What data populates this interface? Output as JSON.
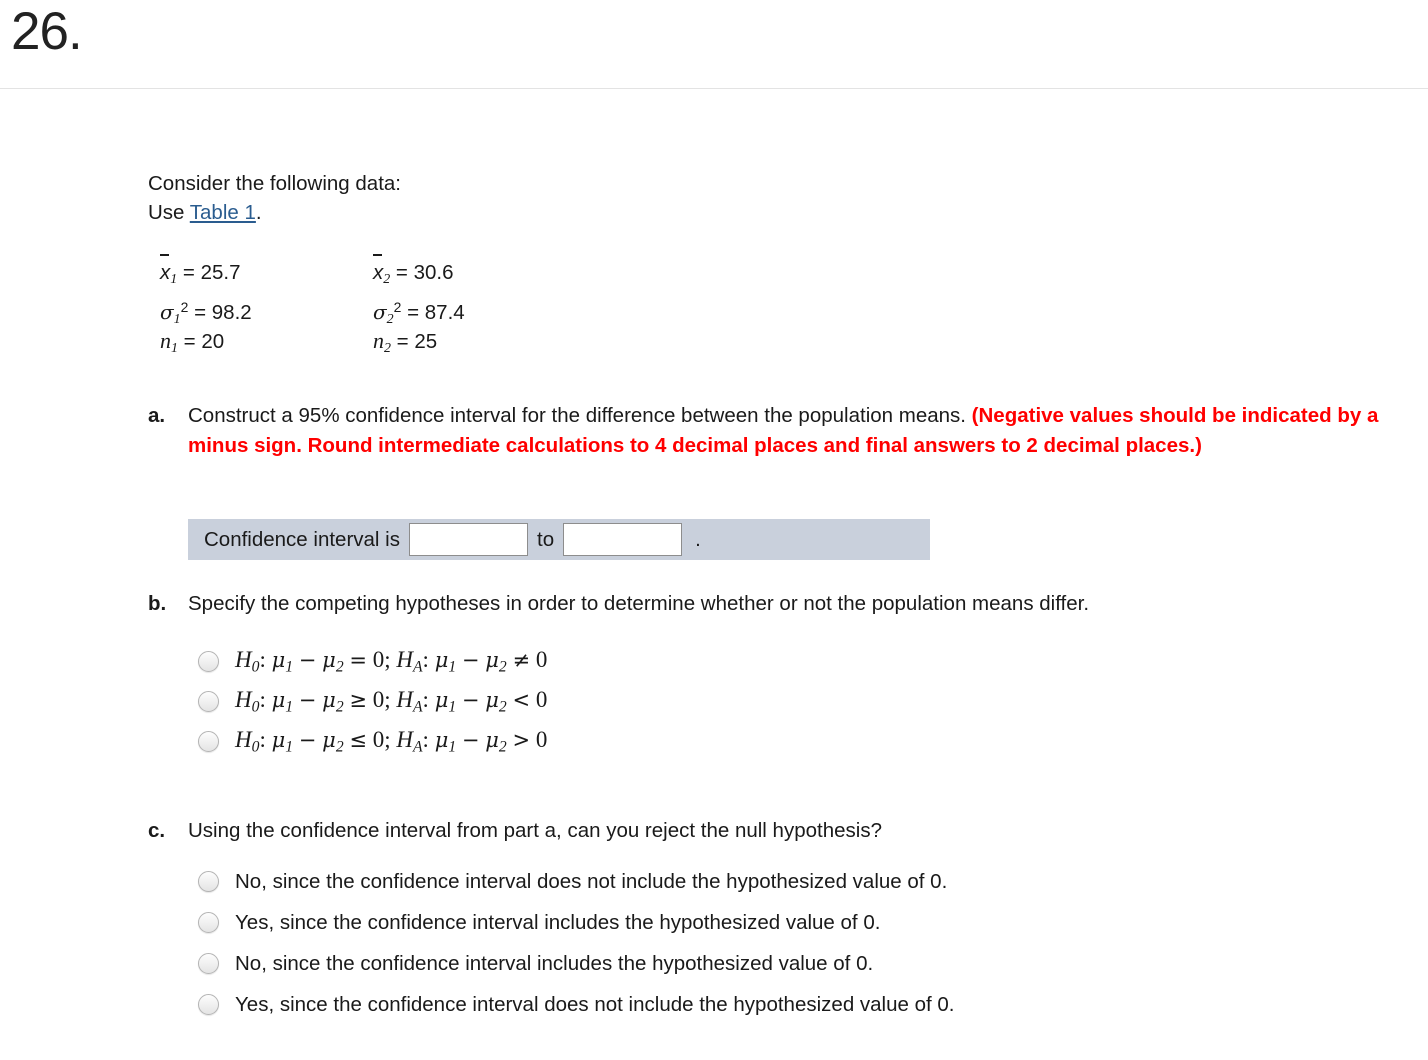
{
  "header": {
    "question_number": "26."
  },
  "intro": {
    "line1": "Consider the following data:",
    "use_prefix": "Use ",
    "table_link": "Table 1",
    "use_suffix": "."
  },
  "data": {
    "rows": [
      {
        "c1_var": "x",
        "c1_sub": "1",
        "c1_val": "= 25.7",
        "c2_var": "x",
        "c2_sub": "2",
        "c2_val": "= 30.6"
      },
      {
        "c1_var": "σ",
        "c1_sub": "1",
        "c1_sup": "2",
        "c1_val": "= 98.2",
        "c2_var": "σ",
        "c2_sub": "2",
        "c2_sup": "2",
        "c2_val": "= 87.4"
      },
      {
        "c1_var": "n",
        "c1_sub": "1",
        "c1_val": "= 20",
        "c2_var": "n",
        "c2_sub": "2",
        "c2_val": "= 25"
      }
    ]
  },
  "parts": {
    "a": {
      "letter": "a.",
      "text": "Construct a 95% confidence interval for the difference between the population means. ",
      "emphasis": "(Negative values should be indicated by a minus sign. Round intermediate calculations to 4 decimal places and final answers to 2 decimal places.)"
    },
    "b": {
      "letter": "b.",
      "text": "Specify the competing hypotheses in order to determine whether or not the population means differ."
    },
    "c": {
      "letter": "c.",
      "text": "Using the confidence interval from part a, can you reject the null hypothesis?"
    }
  },
  "answer_row": {
    "label": "Confidence interval is",
    "lower_value": "",
    "upper_value": "",
    "lower_placeholder": "",
    "upper_placeholder": "",
    "between_label": "to",
    "period": "."
  },
  "hypothesis_options": [
    {
      "null_op": "=",
      "alt_op": "≠",
      "value": "0"
    },
    {
      "null_op": "≥",
      "alt_op": "<",
      "value": "0"
    },
    {
      "null_op": "≤",
      "alt_op": ">",
      "value": "0"
    }
  ],
  "reject_options": [
    {
      "label": "No, since the confidence interval does not include the hypothesized value of 0."
    },
    {
      "label": "Yes, since the confidence interval includes the hypothesized value of 0."
    },
    {
      "label": "No, since the confidence interval includes the hypothesized value of 0."
    },
    {
      "label": "Yes, since the confidence interval does not include the hypothesized value of 0."
    }
  ],
  "colors": {
    "emphasis_red": "#ff0000",
    "link_blue": "#2a5c8f",
    "answer_row_bg": "#c9d0dc",
    "divider": "#e3e3e3"
  }
}
